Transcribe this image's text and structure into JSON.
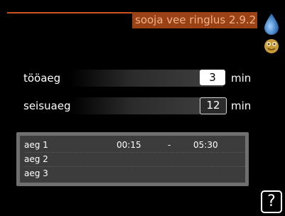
{
  "header": {
    "title": "sooja vee ringlus 2.9.2"
  },
  "icons": {
    "status": "water-drop-icon",
    "mood": "smiley-icon",
    "help": "help-icon"
  },
  "settings": [
    {
      "label": "tööaeg",
      "value": "3",
      "unit": "min"
    },
    {
      "label": "seisuaeg",
      "value": "12",
      "unit": "min"
    }
  ],
  "schedule": [
    {
      "label": "aeg 1",
      "start": "00:15",
      "separator": "-",
      "end": "05:30"
    },
    {
      "label": "aeg 2",
      "start": "",
      "separator": "",
      "end": ""
    },
    {
      "label": "aeg 3",
      "start": "",
      "separator": "",
      "end": ""
    }
  ],
  "help": {
    "symbol": "?"
  },
  "colors": {
    "accent": "#c8531e",
    "title_bg": "#9a4216",
    "drop": "#2f7fc4"
  }
}
